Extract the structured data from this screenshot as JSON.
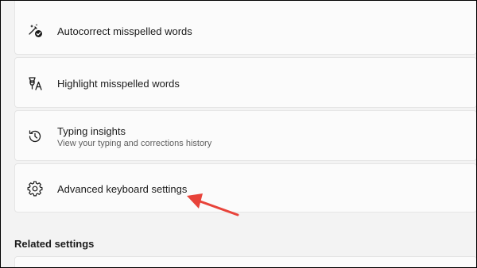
{
  "settings": {
    "autocorrect": {
      "title": "Autocorrect misspelled words",
      "icon": "autocorrect-icon"
    },
    "highlight": {
      "title": "Highlight misspelled words",
      "icon": "highlight-spelling-icon"
    },
    "typing_insights": {
      "title": "Typing insights",
      "subtitle": "View your typing and corrections history",
      "icon": "history-icon"
    },
    "advanced_keyboard": {
      "title": "Advanced keyboard settings",
      "icon": "gear-icon"
    }
  },
  "related": {
    "heading": "Related settings"
  },
  "colors": {
    "annotation_arrow": "#e8433a",
    "background": "#f3f3f3",
    "card": "#fbfbfb"
  }
}
